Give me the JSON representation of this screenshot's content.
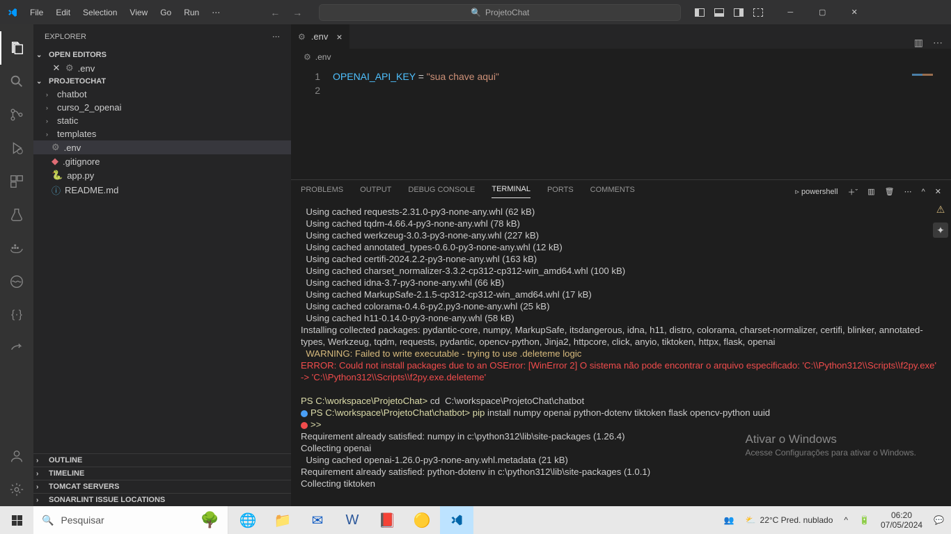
{
  "menu": [
    "File",
    "Edit",
    "Selection",
    "View",
    "Go",
    "Run"
  ],
  "searchPlaceholder": "ProjetoChat",
  "activity": [
    "files",
    "search",
    "git",
    "debug",
    "extensions",
    "test",
    "docker",
    "wave",
    "json",
    "share"
  ],
  "sidebar": {
    "title": "EXPLORER",
    "openEditors": "OPEN EDITORS",
    "openFile": ".env",
    "project": "PROJETOCHAT",
    "folders": [
      "chatbot",
      "curso_2_openai",
      "static",
      "templates"
    ],
    "files": [
      ".env",
      ".gitignore",
      "app.py",
      "README.md"
    ],
    "panels": [
      "OUTLINE",
      "TIMELINE",
      "TOMCAT SERVERS",
      "SONARLINT ISSUE LOCATIONS"
    ]
  },
  "editor": {
    "tab": ".env",
    "breadcrumb": ".env",
    "line1_key": "OPENAI_API_KEY",
    "line1_eq": " = ",
    "line1_val": "\"sua chave aqui\"",
    "gutter": [
      "1",
      "2"
    ]
  },
  "terminal": {
    "tabs": [
      "PROBLEMS",
      "OUTPUT",
      "DEBUG CONSOLE",
      "TERMINAL",
      "PORTS",
      "COMMENTS"
    ],
    "shell": "powershell",
    "lines": [
      "  Using cached requests-2.31.0-py3-none-any.whl (62 kB)",
      "  Using cached tqdm-4.66.4-py3-none-any.whl (78 kB)",
      "  Using cached werkzeug-3.0.3-py3-none-any.whl (227 kB)",
      "  Using cached annotated_types-0.6.0-py3-none-any.whl (12 kB)",
      "  Using cached certifi-2024.2.2-py3-none-any.whl (163 kB)",
      "  Using cached charset_normalizer-3.3.2-cp312-cp312-win_amd64.whl (100 kB)",
      "  Using cached idna-3.7-py3-none-any.whl (66 kB)",
      "  Using cached MarkupSafe-2.1.5-cp312-cp312-win_amd64.whl (17 kB)",
      "  Using cached colorama-0.4.6-py2.py3-none-any.whl (25 kB)",
      "  Using cached h11-0.14.0-py3-none-any.whl (58 kB)",
      "Installing collected packages: pydantic-core, numpy, MarkupSafe, itsdangerous, idna, h11, distro, colorama, charset-normalizer, certifi, blinker, annotated-types, Werkzeug, tqdm, requests, pydantic, opencv-python, Jinja2, httpcore, click, anyio, tiktoken, httpx, flask, openai"
    ],
    "warning": "  WARNING: Failed to write executable - trying to use .deleteme logic",
    "error": "ERROR: Could not install packages due to an OSError: [WinError 2] O sistema não pode encontrar o arquivo especificado: 'C:\\\\Python312\\\\Scripts\\\\f2py.exe' -> 'C:\\\\Python312\\\\Scripts\\\\f2py.exe.deleteme'",
    "prompt1_a": "PS C:\\workspace\\ProjetoChat> ",
    "prompt1_b": "cd  C:\\workspace\\ProjetoChat\\chatbot",
    "prompt2_a": "PS C:\\workspace\\ProjetoChat\\chatbot> ",
    "prompt2_b": "pip",
    "prompt2_c": " install numpy openai python-dotenv tiktoken flask opencv-python uuid",
    "chev": ">>",
    "out1": "Requirement already satisfied: numpy in c:\\python312\\lib\\site-packages (1.26.4)",
    "out2": "Collecting openai",
    "out3": "  Using cached openai-1.26.0-py3-none-any.whl.metadata (21 kB)",
    "out4": "Requirement already satisfied: python-dotenv in c:\\python312\\lib\\site-packages (1.0.1)",
    "out5": "Collecting tiktoken"
  },
  "watermark": {
    "title": "Ativar o Windows",
    "sub": "Acesse Configurações para ativar o Windows."
  },
  "taskbar": {
    "searchPlaceholder": "Pesquisar",
    "weather": "22°C  Pred. nublado",
    "time": "06:20",
    "date": "07/05/2024"
  }
}
